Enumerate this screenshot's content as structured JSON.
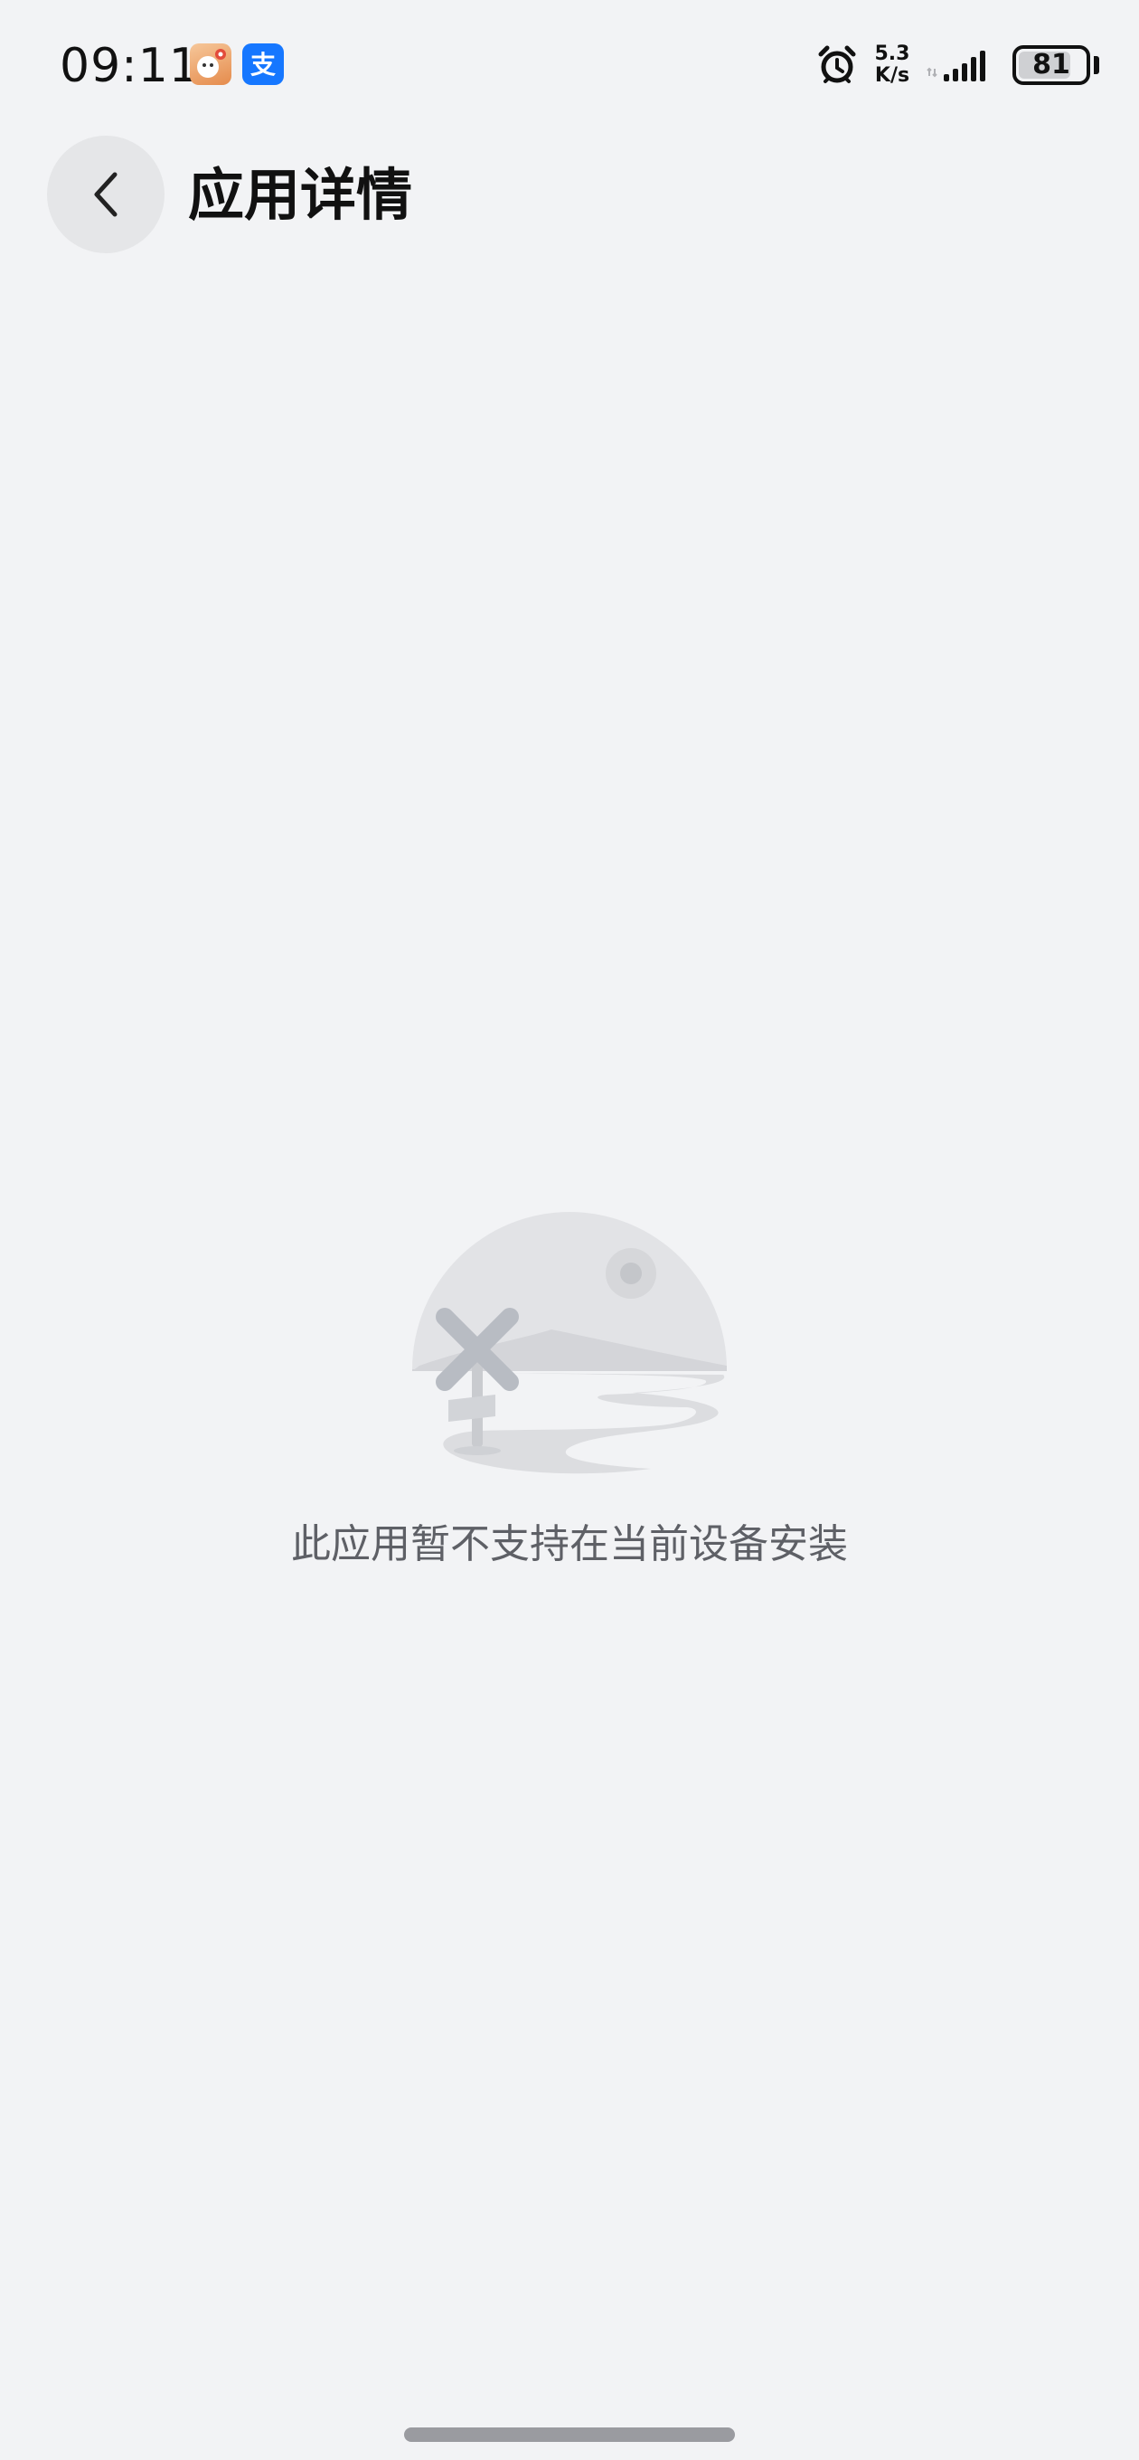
{
  "status_bar": {
    "time": "09:11",
    "notifications": [
      "app-icon",
      "alipay-icon"
    ],
    "alipay_glyph": "支",
    "net_speed_value": "5.3",
    "net_speed_unit": "K/s",
    "battery_level": "81",
    "battery_fraction": 0.81
  },
  "header": {
    "title": "应用详情",
    "back_icon": "chevron-left-icon"
  },
  "empty_state": {
    "illustration": "no-entry-landscape-icon",
    "message": "此应用暂不支持在当前设备安装"
  },
  "colors": {
    "background": "#f2f3f5",
    "back_button_bg": "#e5e6e8",
    "message_text": "#5e6066",
    "alipay_blue": "#1677ff"
  }
}
